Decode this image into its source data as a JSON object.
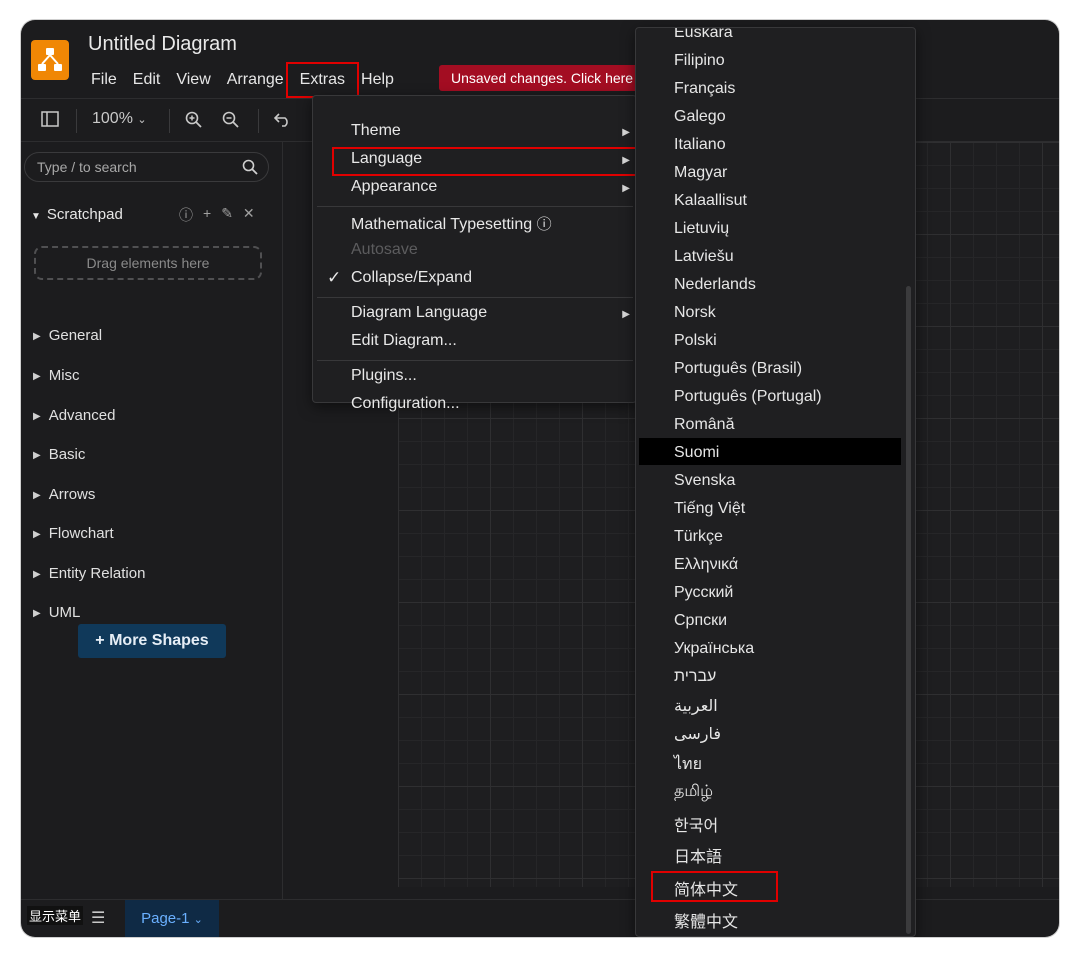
{
  "app": {
    "title": "Untitled Diagram",
    "menubar": [
      "File",
      "Edit",
      "View",
      "Arrange",
      "Extras",
      "Help"
    ],
    "unsaved": "Unsaved changes. Click here to save."
  },
  "toolbar": {
    "zoom": "100%"
  },
  "sidebar": {
    "search_placeholder": "Type / to search",
    "scratchpad": "Scratchpad",
    "dropzone": "Drag elements here",
    "categories": [
      "General",
      "Misc",
      "Advanced",
      "Basic",
      "Arrows",
      "Flowchart",
      "Entity Relation",
      "UML"
    ],
    "more_shapes": "More Shapes"
  },
  "extras_menu": {
    "items": [
      "Theme",
      "Language",
      "Appearance",
      "Mathematical Typesetting",
      "Autosave",
      "Collapse/Expand",
      "Diagram Language",
      "Edit Diagram...",
      "Plugins...",
      "Configuration..."
    ]
  },
  "language_menu": {
    "items": [
      "Euskara",
      "Filipino",
      "Français",
      "Galego",
      "Italiano",
      "Magyar",
      "Kalaallisut",
      "Lietuvių",
      "Latviešu",
      "Nederlands",
      "Norsk",
      "Polski",
      "Português (Brasil)",
      "Português (Portugal)",
      "Română",
      "Suomi",
      "Svenska",
      "Tiếng Việt",
      "Türkçe",
      "Ελληνικά",
      "Русский",
      "Српски",
      "Українська",
      "עברית",
      "العربية",
      "فارسی",
      "ไทย",
      "தமிழ்",
      "한국어",
      "日本語",
      "简体中文",
      "繁體中文"
    ],
    "hovered": "Suomi",
    "marked": "简体中文"
  },
  "footer": {
    "show_menu": "显示菜单",
    "page_tab": "Page-1"
  },
  "colors": {
    "logo": "#f08705",
    "unsaved_bg": "#a30d22",
    "highlight_box": "#e00000",
    "page_tab_text": "#6ab0ff",
    "more_shapes_bg": "#10395a"
  }
}
